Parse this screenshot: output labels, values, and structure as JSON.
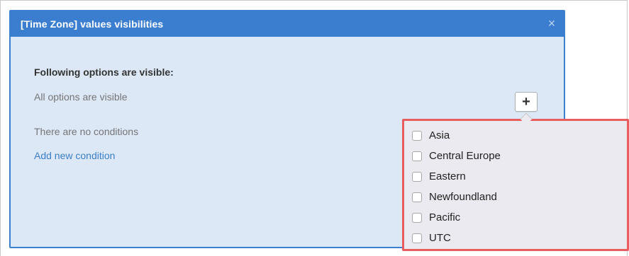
{
  "dialog": {
    "title": "[Time Zone] values visibilities",
    "close_icon": "close-icon"
  },
  "body": {
    "visible_heading": "Following options are visible:",
    "all_visible_text": "All options are visible",
    "no_conditions_text": "There are no conditions",
    "add_condition_link": "Add new condition"
  },
  "add_button": {
    "icon": "plus-icon",
    "label": "+"
  },
  "dropdown": {
    "options": [
      {
        "label": "Asia",
        "checked": false
      },
      {
        "label": "Central Europe",
        "checked": false
      },
      {
        "label": "Eastern",
        "checked": false
      },
      {
        "label": "Newfoundland",
        "checked": false
      },
      {
        "label": "Pacific",
        "checked": false
      },
      {
        "label": "UTC",
        "checked": false
      }
    ]
  },
  "colors": {
    "header_bg": "#3b7ed0",
    "dialog_bg": "#dde8f6",
    "link": "#3a7ec8",
    "highlight_border": "#e85d5d"
  }
}
